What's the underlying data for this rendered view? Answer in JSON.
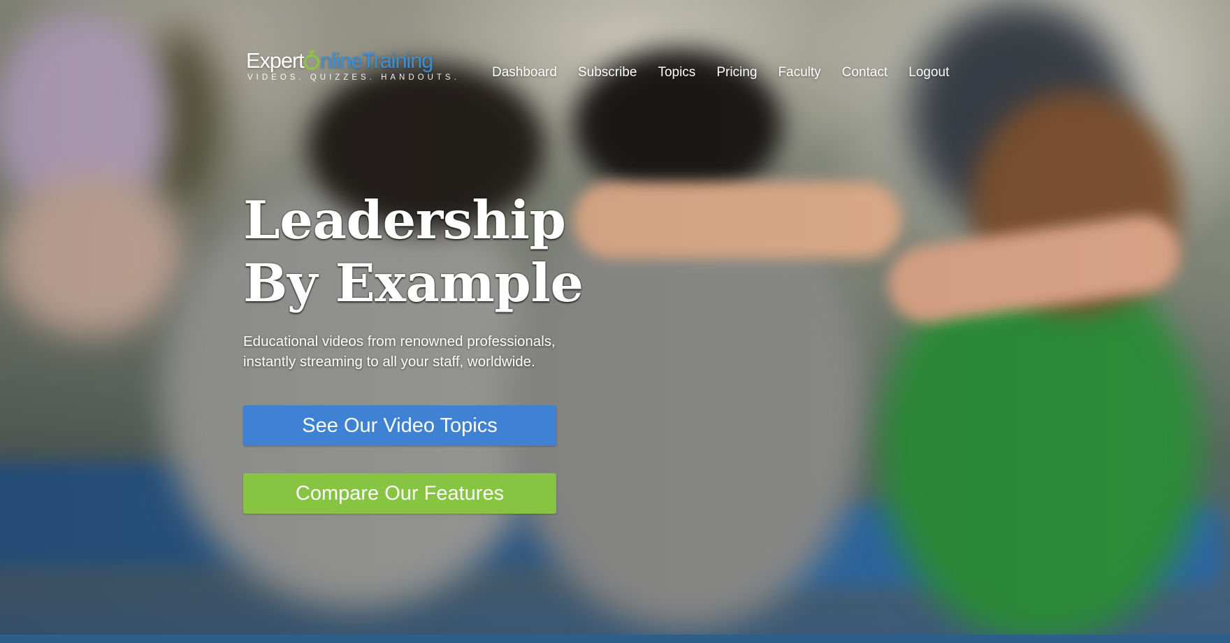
{
  "logo": {
    "part1": "Expert",
    "part2": "nline",
    "part3": "Training",
    "tagline": "VIDEOS. QUIZZES. HANDOUTS."
  },
  "nav": {
    "items": [
      {
        "label": "Dashboard"
      },
      {
        "label": "Subscribe"
      },
      {
        "label": "Topics"
      },
      {
        "label": "Pricing"
      },
      {
        "label": "Faculty"
      },
      {
        "label": "Contact"
      },
      {
        "label": "Logout"
      }
    ]
  },
  "hero": {
    "title_line1": "Leadership",
    "title_line2": "By Example",
    "subtitle_line1": "Educational videos from renowned professionals,",
    "subtitle_line2": "instantly streaming to all your staff, worldwide.",
    "primary_cta": "See Our Video Topics",
    "secondary_cta": "Compare Our Features"
  },
  "colors": {
    "primary_button": "#3f82d3",
    "secondary_button": "#86c441",
    "logo_accent": "#3b8fd8",
    "logo_leaf": "#8cc63f",
    "bottom_bar": "#2c5f8a"
  }
}
